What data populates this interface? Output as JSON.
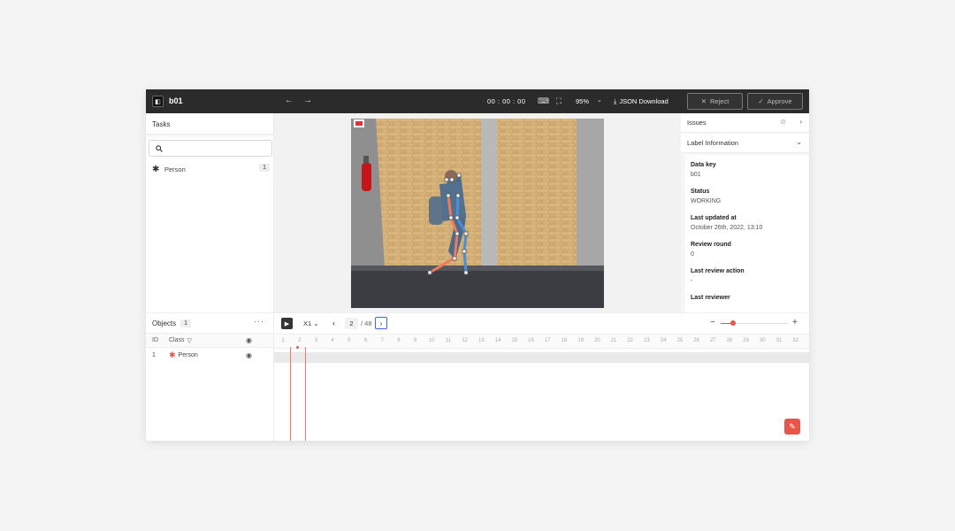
{
  "topbar": {
    "data_key": "b01",
    "timecode": "00 : 00 : 00",
    "zoom": "95%",
    "json_download": "JSON Download",
    "reject": "Reject",
    "approve": "Approve"
  },
  "tasks": {
    "title": "Tasks",
    "search_placeholder": "",
    "items": [
      {
        "label": "Person",
        "count": "1"
      }
    ]
  },
  "right_panel": {
    "issues": "Issues",
    "label_info": "Label Information",
    "fields": [
      {
        "label": "Data key",
        "value": "b01"
      },
      {
        "label": "Status",
        "value": "WORKING"
      },
      {
        "label": "Last updated at",
        "value": "October 26th, 2022, 13:10"
      },
      {
        "label": "Review round",
        "value": "0"
      },
      {
        "label": "Last review action",
        "value": "-"
      },
      {
        "label": "Last reviewer",
        "value": ""
      }
    ]
  },
  "objects": {
    "title": "Objects",
    "count": "1",
    "col_id": "ID",
    "col_class": "Class",
    "rows": [
      {
        "id": "1",
        "class": "Person"
      }
    ]
  },
  "timeline": {
    "speed": "X1",
    "current_frame": "2",
    "total_frames": "/ 48",
    "ticks": [
      "1",
      "2",
      "3",
      "4",
      "5",
      "6",
      "7",
      "8",
      "9",
      "10",
      "11",
      "12",
      "13",
      "14",
      "15",
      "16",
      "17",
      "18",
      "19",
      "20",
      "21",
      "22",
      "23",
      "24",
      "25",
      "26",
      "27",
      "28",
      "29",
      "30",
      "31",
      "32"
    ],
    "zoom_level": 0.18
  },
  "colors": {
    "accent": "#e8554a",
    "topbar": "#2b2b2b",
    "skeleton_left": "#f07a5a",
    "skeleton_right": "#4a8fd8"
  }
}
